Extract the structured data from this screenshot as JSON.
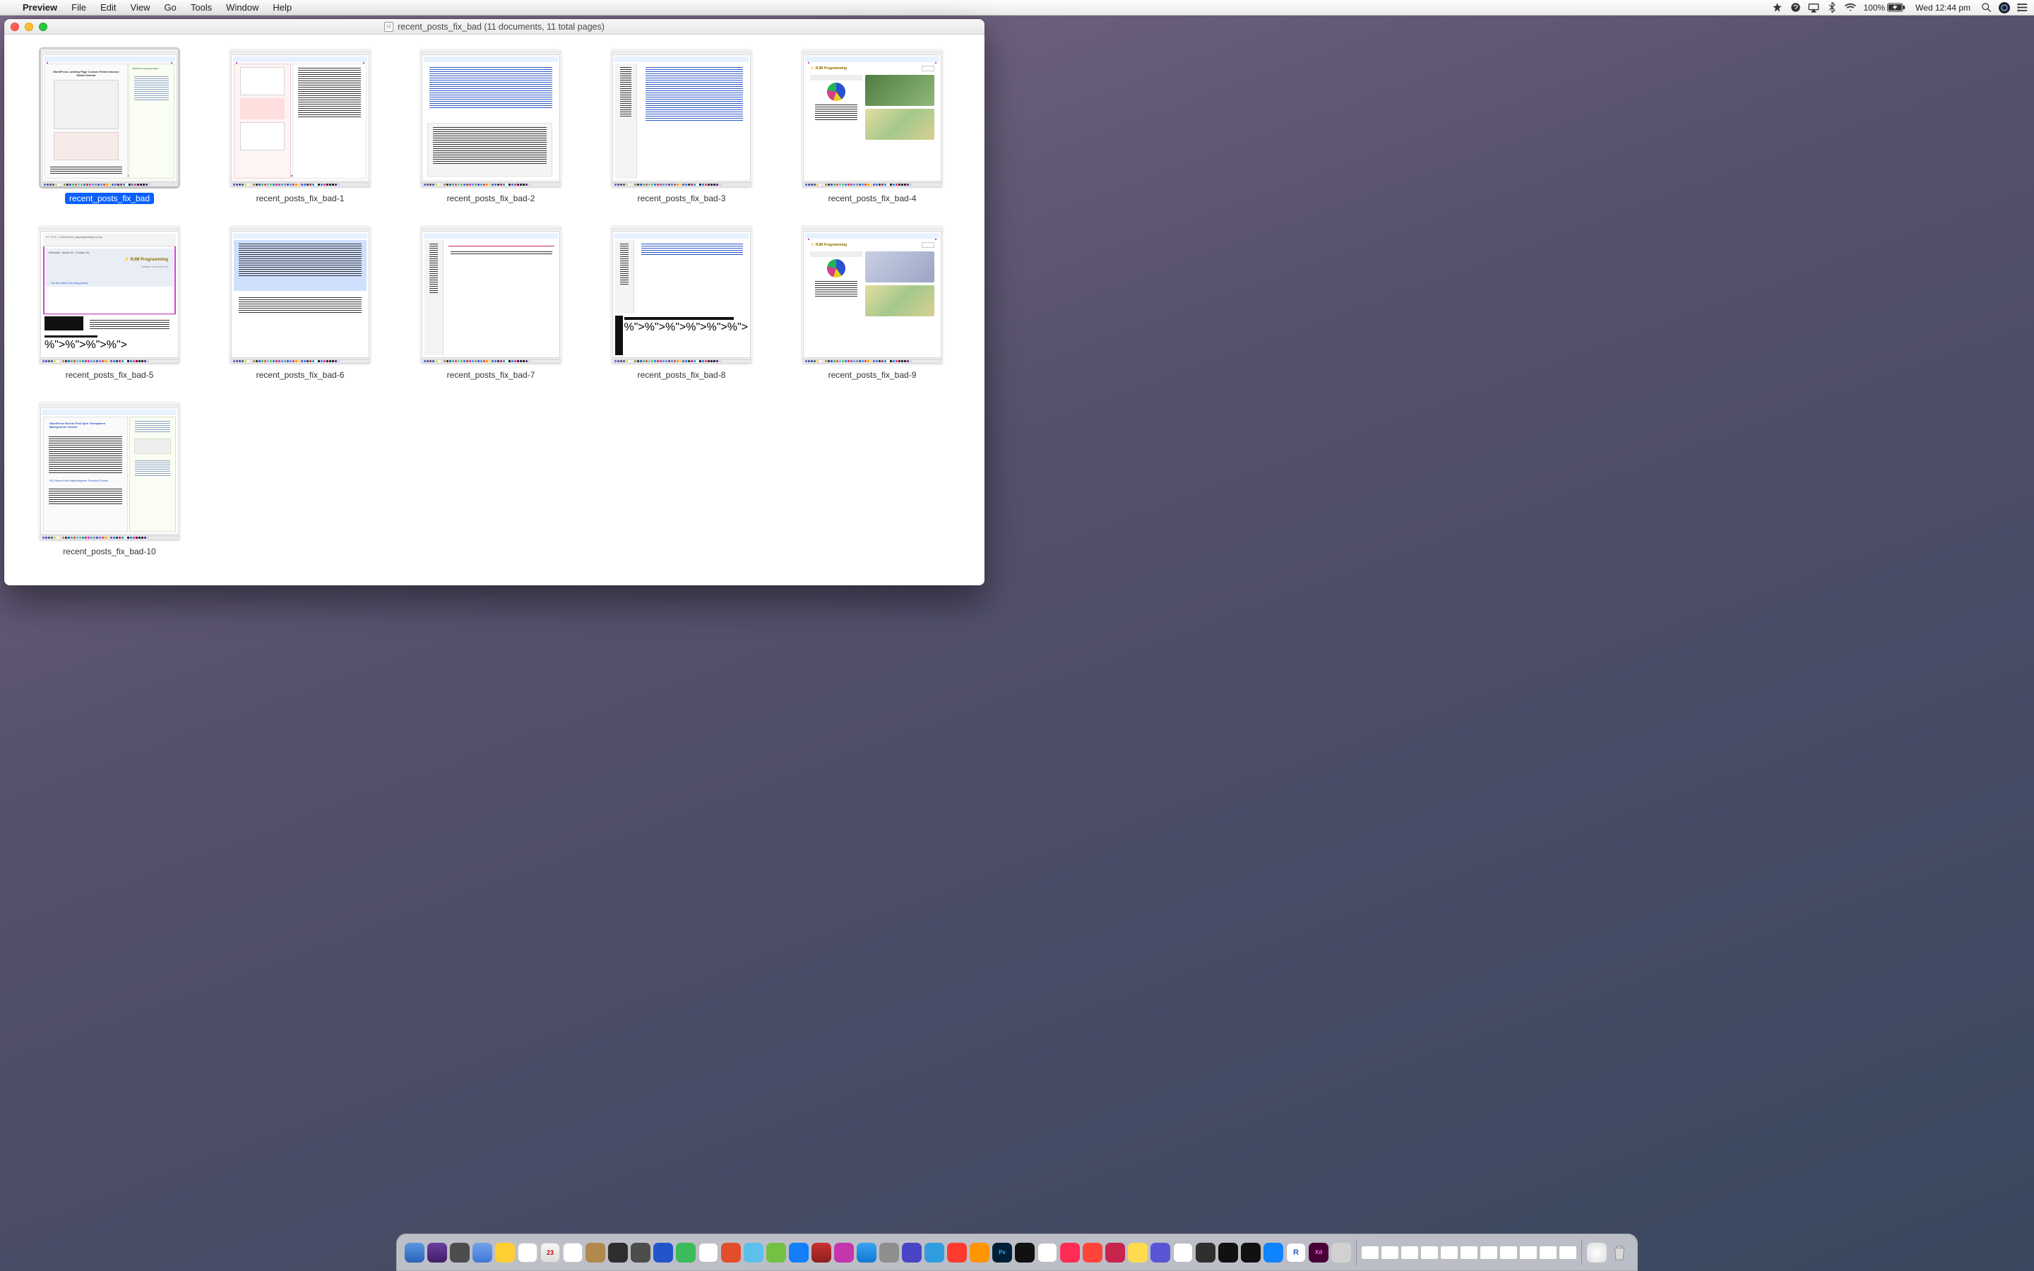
{
  "menubar": {
    "app_name": "Preview",
    "items": [
      "File",
      "Edit",
      "View",
      "Go",
      "Tools",
      "Window",
      "Help"
    ],
    "battery_pct": "100%",
    "clock": "Wed 12:44 pm"
  },
  "window": {
    "title": "recent_posts_fix_bad (11 documents, 11 total pages)"
  },
  "thumbs": [
    {
      "label": "recent_posts_fix_bad",
      "selected": true,
      "variant": "wp1"
    },
    {
      "label": "recent_posts_fix_bad-1",
      "selected": false,
      "variant": "wp2"
    },
    {
      "label": "recent_posts_fix_bad-2",
      "selected": false,
      "variant": "src1"
    },
    {
      "label": "recent_posts_fix_bad-3",
      "selected": false,
      "variant": "src2"
    },
    {
      "label": "recent_posts_fix_bad-4",
      "selected": false,
      "variant": "rjm1"
    },
    {
      "label": "recent_posts_fix_bad-5",
      "selected": false,
      "variant": "chrome"
    },
    {
      "label": "recent_posts_fix_bad-6",
      "selected": false,
      "variant": "editor"
    },
    {
      "label": "recent_posts_fix_bad-7",
      "selected": false,
      "variant": "src3"
    },
    {
      "label": "recent_posts_fix_bad-8",
      "selected": false,
      "variant": "term"
    },
    {
      "label": "recent_posts_fix_bad-9",
      "selected": false,
      "variant": "rjm2"
    },
    {
      "label": "recent_posts_fix_bad-10",
      "selected": false,
      "variant": "wp3"
    }
  ]
}
